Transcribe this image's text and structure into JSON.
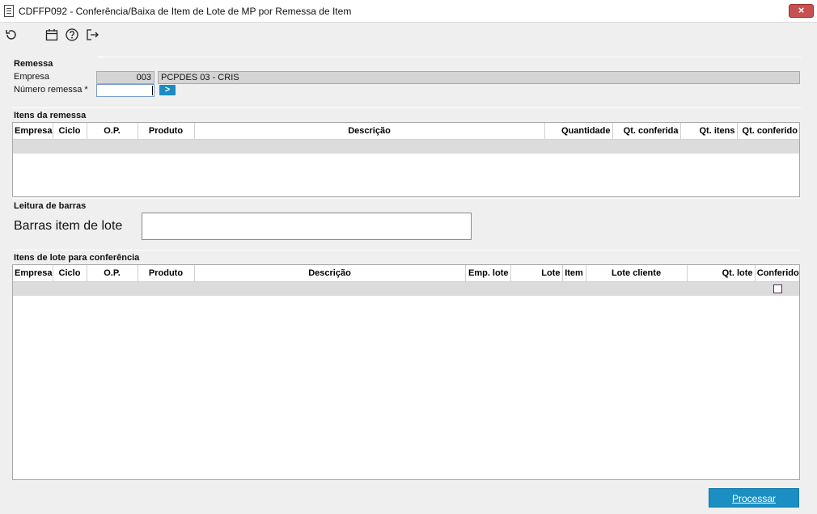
{
  "window": {
    "title": "CDFFP092 - Conferência/Baixa de Item de Lote de MP por Remessa de Item",
    "close_label": "×"
  },
  "toolbar": {
    "icons": [
      "refresh-icon",
      "calendar-icon",
      "help-icon",
      "exit-icon"
    ]
  },
  "remessa": {
    "section_title": "Remessa",
    "empresa_label": "Empresa",
    "empresa_code": "003",
    "empresa_name": "PCPDES 03 - CRIS",
    "numero_label": "Número remessa *",
    "numero_value": "",
    "go_label": ">"
  },
  "itens_remessa": {
    "section_title": "Itens da remessa",
    "columns": [
      "Empresa",
      "Ciclo",
      "O.P.",
      "Produto",
      "Descrição",
      "Quantidade",
      "Qt. conferida",
      "Qt. itens",
      "Qt. conferido"
    ]
  },
  "leitura": {
    "section_title": "Leitura de barras",
    "barras_label": "Barras item de lote",
    "barras_value": ""
  },
  "itens_lote": {
    "section_title": "Itens de lote para conferência",
    "columns": [
      "Empresa",
      "Ciclo",
      "O.P.",
      "Produto",
      "Descrição",
      "Emp. lote",
      "Lote",
      "Item",
      "Lote cliente",
      "Qt. lote",
      "Conferido"
    ],
    "row": {
      "conferido": false
    }
  },
  "footer": {
    "process_label": "Processar"
  },
  "colors": {
    "accent": "#1b8ec4",
    "close": "#c75050",
    "row_bg": "#dcdcdc"
  }
}
